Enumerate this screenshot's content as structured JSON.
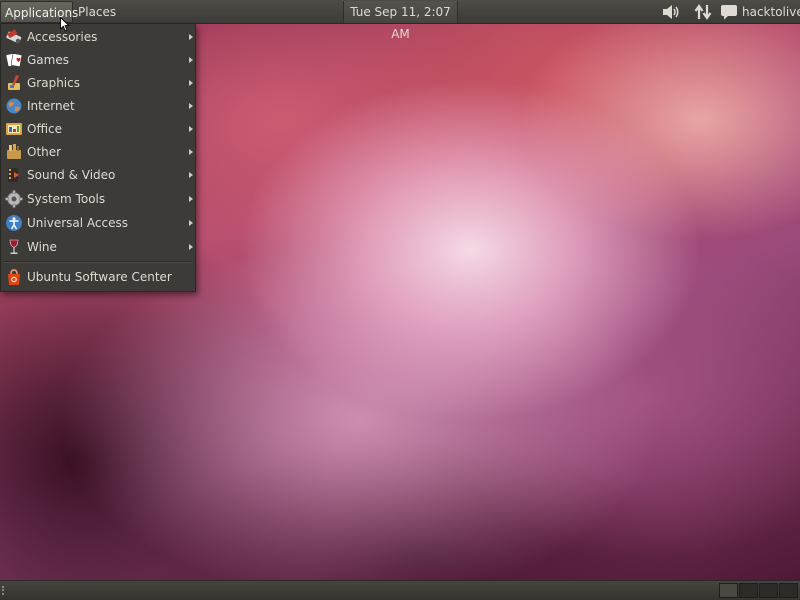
{
  "top_panel": {
    "applications_label": "Applications",
    "places_label": "Places",
    "clock": "Tue Sep 11,  2:07 AM",
    "username": "hacktolive",
    "tray_icons": [
      "volume-icon",
      "network-icon",
      "chat-icon"
    ]
  },
  "applications_menu": {
    "items": [
      {
        "label": "Accessories",
        "icon": "accessories-icon",
        "has_submenu": true
      },
      {
        "label": "Games",
        "icon": "games-icon",
        "has_submenu": true
      },
      {
        "label": "Graphics",
        "icon": "graphics-icon",
        "has_submenu": true
      },
      {
        "label": "Internet",
        "icon": "internet-icon",
        "has_submenu": true
      },
      {
        "label": "Office",
        "icon": "office-icon",
        "has_submenu": true
      },
      {
        "label": "Other",
        "icon": "other-icon",
        "has_submenu": true
      },
      {
        "label": "Sound & Video",
        "icon": "sound-video-icon",
        "has_submenu": true
      },
      {
        "label": "System Tools",
        "icon": "system-tools-icon",
        "has_submenu": true
      },
      {
        "label": "Universal Access",
        "icon": "universal-access-icon",
        "has_submenu": true
      },
      {
        "label": "Wine",
        "icon": "wine-icon",
        "has_submenu": true
      }
    ],
    "footer_item": {
      "label": "Ubuntu Software Center",
      "icon": "software-center-icon"
    }
  },
  "bottom_panel": {
    "workspace_count": 4,
    "active_workspace": 1
  },
  "colors": {
    "panel": "#3c3b37",
    "menu_background": "#3c3b37",
    "menu_text": "#dfdbd2",
    "accent_orange": "#dd4814"
  }
}
